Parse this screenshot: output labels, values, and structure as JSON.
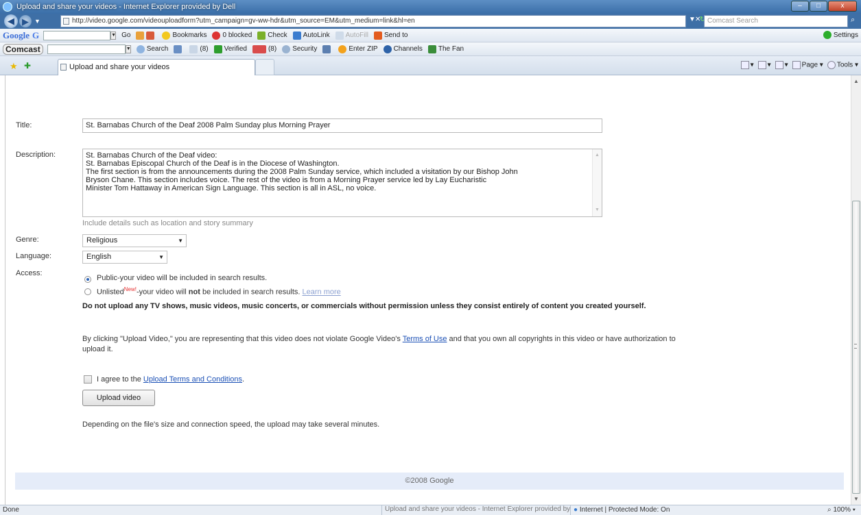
{
  "window": {
    "title": "Upload and share your videos - Internet Explorer provided by Dell",
    "min": "–",
    "max": "□",
    "close": "x"
  },
  "address": {
    "url": "http://video.google.com/videouploadform?utm_campaign=gv-ww-hdr&utm_source=EM&utm_medium=link&hl=en",
    "search_placeholder": "Comcast Search"
  },
  "google_toolbar": {
    "logo": "Google",
    "logo_g": "G",
    "go": "Go",
    "bookmarks": "Bookmarks",
    "blocked": "0 blocked",
    "check": "Check",
    "autolink": "AutoLink",
    "autofill": "AutoFill",
    "sendto": "Send to",
    "settings": "Settings"
  },
  "comcast_toolbar": {
    "logo": "Comcast",
    "search": "Search",
    "count": "(8)",
    "verified": "Verified",
    "security": "Security",
    "enterzip": "Enter ZIP",
    "channels": "Channels",
    "thefan": "The Fan"
  },
  "tabs": {
    "active": "Upload and share your videos",
    "page": "Page",
    "tools": "Tools"
  },
  "form": {
    "title_label": "Title:",
    "title_value": "St. Barnabas Church of the Deaf 2008 Palm Sunday plus Morning Prayer",
    "description_label": "Description:",
    "description_lines": [
      "St. Barnabas Church of the Deaf video:",
      "St. Barnabas Episcopal Church of the Deaf is in the Diocese of Washington.",
      "The first section is from the announcements during the 2008 Palm Sunday service, which included a visitation by our Bishop John",
      "Bryson Chane.  This section includes voice.  The rest of the video is from a Morning Prayer service led by Lay Eucharistic",
      "Minister Tom Hattaway in American Sign Language.  This section is all in ASL, no voice."
    ],
    "description_hint": "Include details such as location and story summary",
    "genre_label": "Genre:",
    "genre_value": "Religious",
    "language_label": "Language:",
    "language_value": "English",
    "access_label": "Access:",
    "public_text": "Public-your video will be included in search results.",
    "unlisted_word": "Unlisted",
    "new_tag": "New!",
    "unlisted_mid": "-your video will ",
    "unlisted_not": "not",
    "unlisted_end": " be included in search results. ",
    "learn_more": "Learn more",
    "warning": "Do not upload any TV shows, music videos, music concerts, or commercials without permission unless they consist entirely of content you created yourself.",
    "legal_pre": "By clicking \"Upload Video,\" you are representing that this video does not violate Google Video's ",
    "terms_of_use": "Terms of Use",
    "legal_post": " and that you own all copyrights in this video or have authorization to upload it.",
    "agree_pre": "I agree to the ",
    "agree_link": "Upload Terms and Conditions",
    "agree_post": ".",
    "upload_button": "Upload video",
    "depending": "Depending on the file's size and connection speed, the upload may take several minutes.",
    "footer": "©2008 Google"
  },
  "status": {
    "left": "Done",
    "taskbar": "Upload and share your videos - Internet Explorer provided by Dell",
    "zone": "Internet | Protected Mode: On",
    "zoom": "100%"
  }
}
